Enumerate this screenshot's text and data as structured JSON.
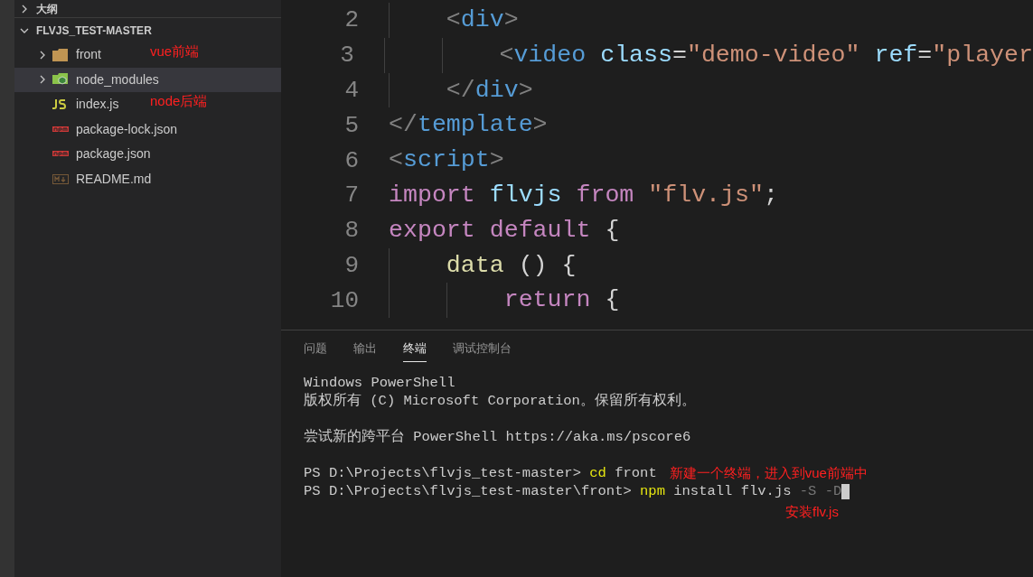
{
  "sidebar": {
    "outline": {
      "label": "大纲",
      "expanded": false
    },
    "project": {
      "label": "FLVJS_TEST-MASTER",
      "expanded": true
    },
    "items": [
      {
        "label": "front",
        "kind": "folder",
        "expanded": false,
        "selected": false,
        "annotation": "vue前端"
      },
      {
        "label": "node_modules",
        "kind": "node-folder",
        "expanded": false,
        "selected": true
      },
      {
        "label": "index.js",
        "kind": "js",
        "selected": false,
        "annotation": "node后端"
      },
      {
        "label": "package-lock.json",
        "kind": "npm",
        "selected": false
      },
      {
        "label": "package.json",
        "kind": "npm",
        "selected": false
      },
      {
        "label": "README.md",
        "kind": "markdown",
        "selected": false
      }
    ]
  },
  "editor": {
    "lines": [
      {
        "number": "2",
        "tokens": [
          {
            "text": "    <",
            "kind": "punct"
          },
          {
            "text": "div",
            "kind": "tag"
          },
          {
            "text": ">",
            "kind": "punct"
          }
        ]
      },
      {
        "number": "3",
        "tokens": [
          {
            "text": "        <",
            "kind": "punct"
          },
          {
            "text": "video",
            "kind": "tag"
          },
          {
            "text": " class",
            "kind": "attr"
          },
          {
            "text": "=",
            "kind": "plain"
          },
          {
            "text": "\"demo-video\"",
            "kind": "string"
          },
          {
            "text": " ref",
            "kind": "attr"
          },
          {
            "text": "=",
            "kind": "plain"
          },
          {
            "text": "\"player",
            "kind": "string"
          }
        ]
      },
      {
        "number": "4",
        "tokens": [
          {
            "text": "    </",
            "kind": "punct"
          },
          {
            "text": "div",
            "kind": "tag"
          },
          {
            "text": ">",
            "kind": "punct"
          }
        ]
      },
      {
        "number": "5",
        "tokens": [
          {
            "text": "</",
            "kind": "punct"
          },
          {
            "text": "template",
            "kind": "tag"
          },
          {
            "text": ">",
            "kind": "punct"
          }
        ]
      },
      {
        "number": "6",
        "tokens": [
          {
            "text": "<",
            "kind": "punct"
          },
          {
            "text": "script",
            "kind": "tag"
          },
          {
            "text": ">",
            "kind": "punct"
          }
        ]
      },
      {
        "number": "7",
        "tokens": [
          {
            "text": "import",
            "kind": "keyword"
          },
          {
            "text": " flvjs",
            "kind": "variable"
          },
          {
            "text": " from",
            "kind": "keyword"
          },
          {
            "text": " \"flv.js\"",
            "kind": "string"
          },
          {
            "text": ";",
            "kind": "plain"
          }
        ]
      },
      {
        "number": "8",
        "tokens": [
          {
            "text": "export",
            "kind": "keyword"
          },
          {
            "text": " default",
            "kind": "keyword"
          },
          {
            "text": " {",
            "kind": "plain"
          }
        ]
      },
      {
        "number": "9",
        "tokens": [
          {
            "text": "    data",
            "kind": "function"
          },
          {
            "text": " () {",
            "kind": "plain"
          }
        ]
      },
      {
        "number": "10",
        "tokens": [
          {
            "text": "        return",
            "kind": "keyword"
          },
          {
            "text": " {",
            "kind": "plain"
          }
        ]
      }
    ]
  },
  "panel": {
    "tabs": [
      {
        "label": "问题",
        "selected": false
      },
      {
        "label": "输出",
        "selected": false
      },
      {
        "label": "终端",
        "selected": true
      },
      {
        "label": "调试控制台",
        "selected": false
      }
    ],
    "terminal": {
      "lines": [
        {
          "kind": "text",
          "tokens": [
            {
              "text": "Windows PowerShell",
              "kind": "plain"
            }
          ]
        },
        {
          "kind": "text",
          "tokens": [
            {
              "text": "版权所有 (C) Microsoft Corporation。保留所有权利。",
              "kind": "plain"
            }
          ]
        },
        {
          "kind": "blank"
        },
        {
          "kind": "text",
          "tokens": [
            {
              "text": "尝试新的跨平台 PowerShell https://aka.ms/pscore6",
              "kind": "plain"
            }
          ]
        },
        {
          "kind": "blank"
        },
        {
          "kind": "text",
          "tokens": [
            {
              "text": "PS D:\\Projects\\flvjs_test-master> ",
              "kind": "plain"
            },
            {
              "text": "cd",
              "kind": "command"
            },
            {
              "text": " front",
              "kind": "plain"
            }
          ],
          "annotation": "新建一个终端，进入到vue前端中"
        },
        {
          "kind": "text",
          "tokens": [
            {
              "text": "PS D:\\Projects\\flvjs_test-master\\front> ",
              "kind": "plain"
            },
            {
              "text": "npm",
              "kind": "command"
            },
            {
              "text": " install flv.js ",
              "kind": "plain"
            },
            {
              "text": "-S -D",
              "kind": "flag"
            }
          ],
          "cursor": true
        }
      ],
      "note": "安装flv.js"
    }
  }
}
